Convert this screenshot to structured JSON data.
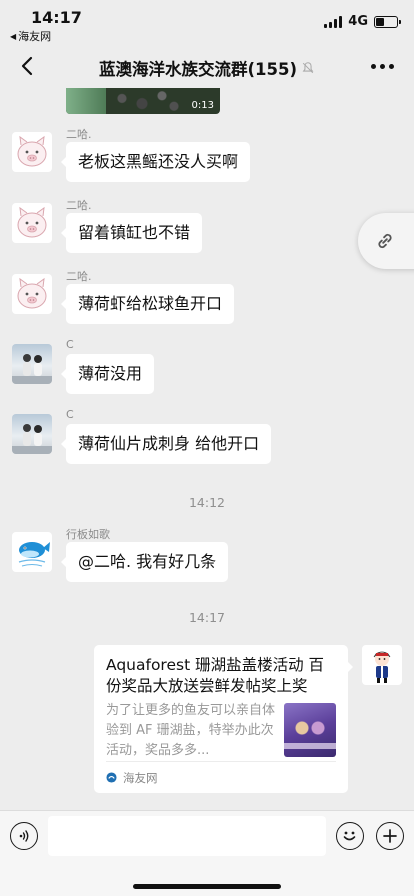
{
  "status_bar": {
    "time": "14:17",
    "back_app": "海友网",
    "network": "4G",
    "battery_level": 0.4
  },
  "header": {
    "title": "蓝澳海洋水族交流群(155)"
  },
  "video": {
    "duration": "0:13"
  },
  "messages": [
    {
      "sender": "二哈.",
      "text": "老板这黑鳐还没人买啊",
      "avatar": "pig-avatar"
    },
    {
      "sender": "二哈.",
      "text": "留着镇缸也不错",
      "avatar": "pig-avatar"
    },
    {
      "sender": "二哈.",
      "text": "薄荷虾给松球鱼开口",
      "avatar": "pig-avatar"
    },
    {
      "sender": "C",
      "text": "薄荷没用",
      "avatar": "couple-photo-avatar"
    },
    {
      "sender": "C",
      "text": "薄荷仙片成刺身 给他开口",
      "avatar": "couple-photo-avatar"
    },
    {
      "sender": "行板如歌",
      "text": "@二哈. 我有好几条",
      "avatar": "whale-avatar"
    }
  ],
  "timestamps": [
    "14:12",
    "14:17"
  ],
  "link_card": {
    "title": "Aquaforest 珊湖盐盖楼活动 百份奖品大放送尝鲜发帖奖上奖",
    "description": "为了让更多的鱼友可以亲自体验到 AF 珊湖盐，特举办此次活动，奖品多多...",
    "source": "海友网"
  },
  "colors": {
    "background": "#ededed",
    "bubble": "#ffffff",
    "meta_text": "#8a8a8a"
  }
}
